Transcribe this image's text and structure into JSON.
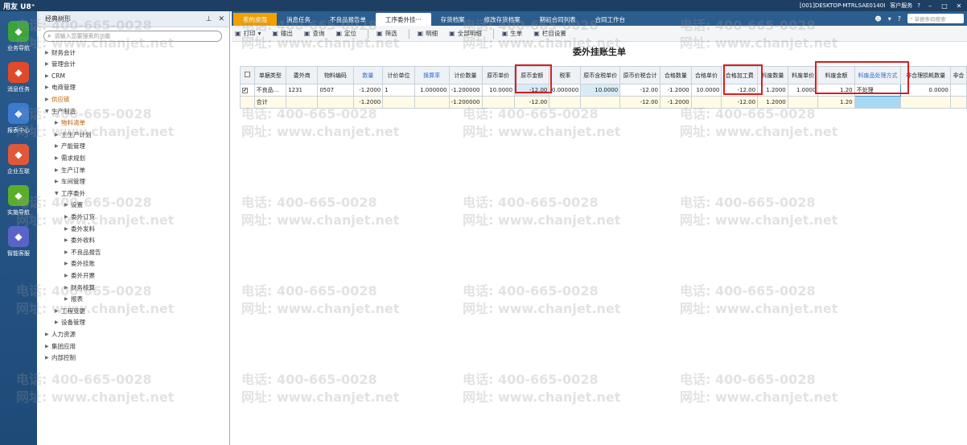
{
  "titlebar": {
    "brand": "用友 U8⁺",
    "session": "[001]DESKTOP-MTRLSAE0140I",
    "service": "客户服务",
    "help": "?"
  },
  "leftnav": [
    {
      "label": "业务导航",
      "icon": "business-nav-icon",
      "color": "#3aa43a"
    },
    {
      "label": "消息任务",
      "icon": "message-task-icon",
      "color": "#e04a2a"
    },
    {
      "label": "报表中心",
      "icon": "report-center-icon",
      "color": "#3a7bd0"
    },
    {
      "label": "企业互联",
      "icon": "enterprise-link-icon",
      "color": "#e0583a"
    },
    {
      "label": "实施导航",
      "icon": "implement-nav-icon",
      "color": "#5aae2a"
    },
    {
      "label": "智能客服",
      "icon": "smart-service-icon",
      "color": "#5a64c8"
    }
  ],
  "tree": {
    "title": "经典树形",
    "search_placeholder": "请输入您要搜索的功能",
    "nodes": [
      {
        "label": "财务会计",
        "level": 0,
        "arrow": "▶"
      },
      {
        "label": "管理会计",
        "level": 0,
        "arrow": "▶"
      },
      {
        "label": "CRM",
        "level": 0,
        "arrow": "▶"
      },
      {
        "label": "电商管理",
        "level": 0,
        "arrow": "▶"
      },
      {
        "label": "供应链",
        "level": 0,
        "arrow": "▶",
        "selected": true
      },
      {
        "label": "生产制造",
        "level": 0,
        "arrow": "▼"
      },
      {
        "label": "物料清单",
        "level": 1,
        "arrow": "▶",
        "selected": true
      },
      {
        "label": "主生产计划",
        "level": 1,
        "arrow": "▶"
      },
      {
        "label": "产能管理",
        "level": 1,
        "arrow": "▶"
      },
      {
        "label": "需求规划",
        "level": 1,
        "arrow": "▶"
      },
      {
        "label": "生产订单",
        "level": 1,
        "arrow": "▶"
      },
      {
        "label": "车间管理",
        "level": 1,
        "arrow": "▶"
      },
      {
        "label": "工序委外",
        "level": 1,
        "arrow": "▼"
      },
      {
        "label": "设置",
        "level": 2,
        "arrow": "▶"
      },
      {
        "label": "委外订货",
        "level": 2,
        "arrow": "▶"
      },
      {
        "label": "委外发料",
        "level": 2,
        "arrow": "▶"
      },
      {
        "label": "委外收料",
        "level": 2,
        "arrow": "▶"
      },
      {
        "label": "不良品报告",
        "level": 2,
        "arrow": "▶"
      },
      {
        "label": "委外挂账",
        "level": 2,
        "arrow": "▶"
      },
      {
        "label": "委外开票",
        "level": 2,
        "arrow": "▶"
      },
      {
        "label": "财务核算",
        "level": 2,
        "arrow": "▶"
      },
      {
        "label": "报表",
        "level": 2,
        "arrow": "▶"
      },
      {
        "label": "工程变更",
        "level": 1,
        "arrow": "▶"
      },
      {
        "label": "设备管理",
        "level": 1,
        "arrow": "▶"
      },
      {
        "label": "人力资源",
        "level": 0,
        "arrow": "▶"
      },
      {
        "label": "集团应用",
        "level": 0,
        "arrow": "▶"
      },
      {
        "label": "内部控制",
        "level": 0,
        "arrow": "▶"
      }
    ]
  },
  "tabs": [
    {
      "label": "我的桌面",
      "kind": "home"
    },
    {
      "label": "消息任务",
      "kind": ""
    },
    {
      "label": "不良品报告单",
      "kind": ""
    },
    {
      "label": "工序委外挂···",
      "kind": "active"
    },
    {
      "label": "存货档案",
      "kind": ""
    },
    {
      "label": "修改存货档案",
      "kind": ""
    },
    {
      "label": "期初合同列表",
      "kind": ""
    },
    {
      "label": "合同工作台",
      "kind": ""
    }
  ],
  "tab_search_placeholder": "单据条码搜索",
  "toolbar": [
    {
      "label": "打印",
      "icon": "printer-icon",
      "dropdown": "▾"
    },
    {
      "label": "输出",
      "icon": "export-icon"
    },
    {
      "label": "查询",
      "icon": "query-icon"
    },
    {
      "label": "定位",
      "icon": "locate-icon"
    },
    {
      "label": "筛选",
      "icon": "filter-icon"
    },
    {
      "label": "明细",
      "icon": "detail-icon"
    },
    {
      "label": "全部明细",
      "icon": "all-detail-icon"
    },
    {
      "label": "生单",
      "icon": "generate-doc-icon"
    },
    {
      "label": "栏目设置",
      "icon": "column-settings-icon"
    }
  ],
  "document_title": "委外挂账生单",
  "grid": {
    "columns": [
      {
        "label": "",
        "blue": false,
        "w": 18
      },
      {
        "label": "单据类型",
        "blue": false,
        "w": 40
      },
      {
        "label": "委外商",
        "blue": false,
        "w": 40
      },
      {
        "label": "物料编码",
        "blue": false,
        "w": 45
      },
      {
        "label": "数量",
        "blue": true,
        "w": 37
      },
      {
        "label": "计价单位",
        "blue": false,
        "w": 40
      },
      {
        "label": "换算率",
        "blue": true,
        "w": 43
      },
      {
        "label": "计价数量",
        "blue": false,
        "w": 41
      },
      {
        "label": "原币单价",
        "blue": false,
        "w": 41
      },
      {
        "label": "原币金额",
        "blue": false,
        "w": 44
      },
      {
        "label": "税率",
        "blue": false,
        "w": 39
      },
      {
        "label": "原币含税单价",
        "blue": false,
        "w": 49
      },
      {
        "label": "原币价税合计",
        "blue": false,
        "w": 50
      },
      {
        "label": "合格数量",
        "blue": false,
        "w": 39
      },
      {
        "label": "合格单价",
        "blue": false,
        "w": 38
      },
      {
        "label": "合格加工费",
        "blue": false,
        "w": 45
      },
      {
        "label": "料废数量",
        "blue": false,
        "w": 38
      },
      {
        "label": "料废单价",
        "blue": false,
        "w": 38
      },
      {
        "label": "料废金额",
        "blue": false,
        "w": 46
      },
      {
        "label": "料废品处理方式",
        "blue": true,
        "w": 58
      },
      {
        "label": "非合理损耗数量",
        "blue": false,
        "w": 62
      },
      {
        "label": "非合",
        "blue": false,
        "w": 20
      }
    ],
    "row": [
      "✔",
      "不良品…",
      "1231",
      "0507",
      "-1.2000",
      "1",
      "1.000000",
      "-1.200000",
      "10.0000",
      "-12.00",
      "0.000000",
      "10.0000",
      "-12.00",
      "-1.2000",
      "10.0000",
      "-12.00",
      "1.2000",
      "1.0000",
      "1.20",
      "不处理",
      "0.0000",
      ""
    ],
    "sum": [
      "",
      "合计",
      "",
      "",
      "-1.2000",
      "",
      "",
      "-1.200000",
      "",
      "-12.00",
      "",
      "",
      "-12.00",
      "-1.2000",
      "",
      "-12.00",
      "1.2000",
      "",
      "1.20",
      "",
      "",
      ""
    ]
  },
  "watermark": {
    "phone": "电话: 400-665-0028",
    "site": "网址: www.chanjet.net"
  }
}
